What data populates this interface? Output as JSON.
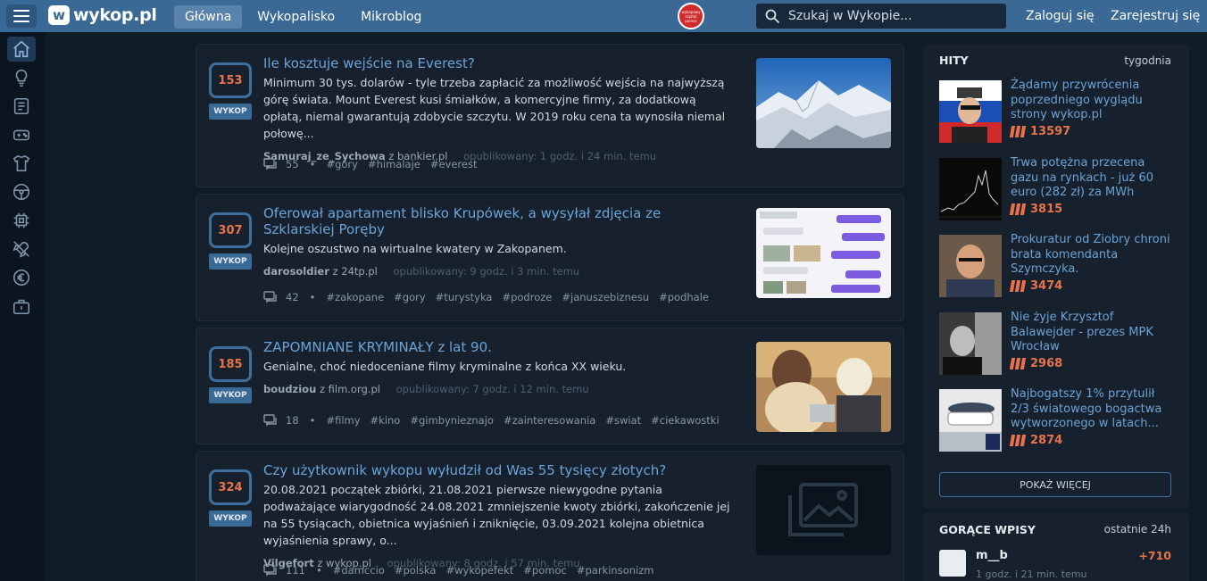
{
  "header": {
    "logo_text": "wykop.pl",
    "logo_mark": "w",
    "nav": [
      "Główna",
      "Wykopalisko",
      "Mikroblog"
    ],
    "badge_text": "wykopowy szpital pomoc",
    "search_placeholder": "Szukaj w Wykopie...",
    "login": "Zaloguj się",
    "register": "Zarejestruj się"
  },
  "sidebar": {
    "icons": [
      "home-icon",
      "lightbulb-icon",
      "news-icon",
      "gamepad-icon",
      "tshirt-icon",
      "steering-wheel-icon",
      "chip-icon",
      "rocket-icon",
      "money-icon",
      "briefcase-icon"
    ]
  },
  "links": [
    {
      "votes": "153",
      "vote_label": "WYKOP",
      "title": "Ile kosztuje wejście na Everest?",
      "description": "Minimum 30 tys. dolarów - tyle trzeba zapłacić za możliwość wejścia na najwyższą górę świata. Mount Everest kusi śmiałków, a komercyjne firmy, za dodatkową opłatą, niemal gwarantują zdobycie szczytu. W 2019 roku cena ta wynosiła niemal połowę...",
      "author": "Samuraj_ze_Sychowa",
      "source": "z bankier.pl",
      "published": "opublikowany: 1 godz. i 24 min. temu",
      "comments": "55",
      "tags": [
        "#gory",
        "#himalaje",
        "#everest"
      ]
    },
    {
      "votes": "307",
      "vote_label": "WYKOP",
      "title": "Oferował apartament blisko Krupówek, a wysyłał zdjęcia ze Szklarskiej Poręby",
      "description": "Kolejne oszustwo na wirtualne kwatery w Zakopanem.",
      "author": "darosoldier",
      "source": "z 24tp.pl",
      "published": "opublikowany: 9 godz. i 3 min. temu",
      "comments": "42",
      "tags": [
        "#zakopane",
        "#gory",
        "#turystyka",
        "#podroze",
        "#januszebiznesu",
        "#podhale"
      ]
    },
    {
      "votes": "185",
      "vote_label": "WYKOP",
      "title": "ZAPOMNIANE KRYMINAŁY z lat 90.",
      "description": "Genialne, choć niedoceniane filmy kryminalne z końca XX wieku.",
      "author": "boudziou",
      "source": "z film.org.pl",
      "published": "opublikowany: 7 godz. i 12 min. temu",
      "comments": "18",
      "tags": [
        "#filmy",
        "#kino",
        "#gimbynieznajo",
        "#zainteresowania",
        "#swiat",
        "#ciekawostki"
      ]
    },
    {
      "votes": "324",
      "vote_label": "WYKOP",
      "title": "Czy użytkownik wykopu wyłudził od Was 55 tysięcy złotych?",
      "description": "20.08.2021 początek zbiórki, 21.08.2021 pierwsze niewygodne pytania podważające wiarygodność 24.08.2021 zmniejszenie kwoty zbiórki, zakończenie jej na 55 tysiącach, obietnica wyjaśnień i zniknięcie, 03.09.2021 kolejna obietnica wyjaśnienia sprawy, o...",
      "author": "Vilgefort",
      "source": "z wykop.pl",
      "published": "opublikowany: 8 godz. i 57 min. temu",
      "comments": "111",
      "tags": [
        "#damccio",
        "#polska",
        "#wykopefekt",
        "#pomoc",
        "#parkinsonizm"
      ]
    }
  ],
  "hits": {
    "title": "HITY",
    "period": "tygodnia",
    "items": [
      {
        "title": "Żądamy przywrócenia poprzedniego wyglądu strony wykop.pl",
        "score": "13597"
      },
      {
        "title": "Trwa potężna przecena gazu na rynkach - już 60 euro (282 zł) za MWh",
        "score": "3815"
      },
      {
        "title": "Prokuratur od Ziobry chroni brata komendanta Szymczyka.",
        "score": "3474"
      },
      {
        "title": "Nie żyje Krzysztof Balawejder - prezes MPK Wrocław",
        "score": "2968"
      },
      {
        "title": "Najbogatszy 1% przytulił 2/3 światowego bogactwa wytworzonego w latach...",
        "score": "2874"
      }
    ],
    "more": "POKAŻ WIĘCEJ"
  },
  "hot": {
    "title": "GORĄCE WPISY",
    "period": "ostatnie 24h",
    "user": "m__b",
    "time": "1 godz. i 21 min. temu",
    "score": "+710"
  },
  "colors": {
    "topbar": "#3a6996",
    "background": "#0f1b26",
    "card": "#16212d",
    "link_title": "#6ca3d6",
    "vote_count": "#e8734a"
  }
}
